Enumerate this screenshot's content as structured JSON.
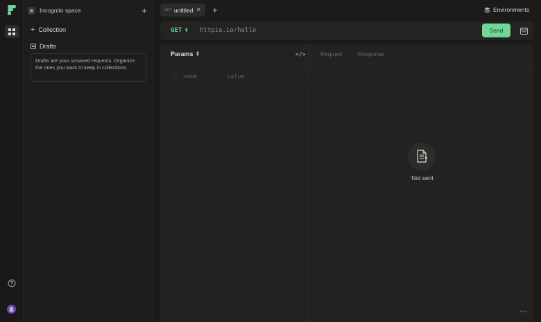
{
  "rail": {
    "logo": "httpie-logo",
    "nav_icon": "grid-icon",
    "help_icon": "help-icon",
    "avatar_icon": "avatar-icon"
  },
  "sidebar": {
    "space_name": "Incognito space",
    "collection_label": "Collection",
    "drafts_label": "Drafts",
    "drafts_help": "Drafts are your unsaved requests. Organize the ones you want to keep in collections."
  },
  "tabs": [
    {
      "method": "GET",
      "name": "untitled"
    }
  ],
  "environments_label": "Environments",
  "request": {
    "method": "GET",
    "url_placeholder": "httpie.io/hello",
    "send_label": "Send"
  },
  "params": {
    "label": "Params",
    "name_placeholder": "name",
    "value_placeholder": "value"
  },
  "response_tabs": {
    "request": "Request",
    "response": "Response"
  },
  "empty_state": {
    "text": "Not sent"
  },
  "colors": {
    "accent": "#6fd898",
    "method": "#5fd088",
    "background": "#1c1b1a"
  }
}
